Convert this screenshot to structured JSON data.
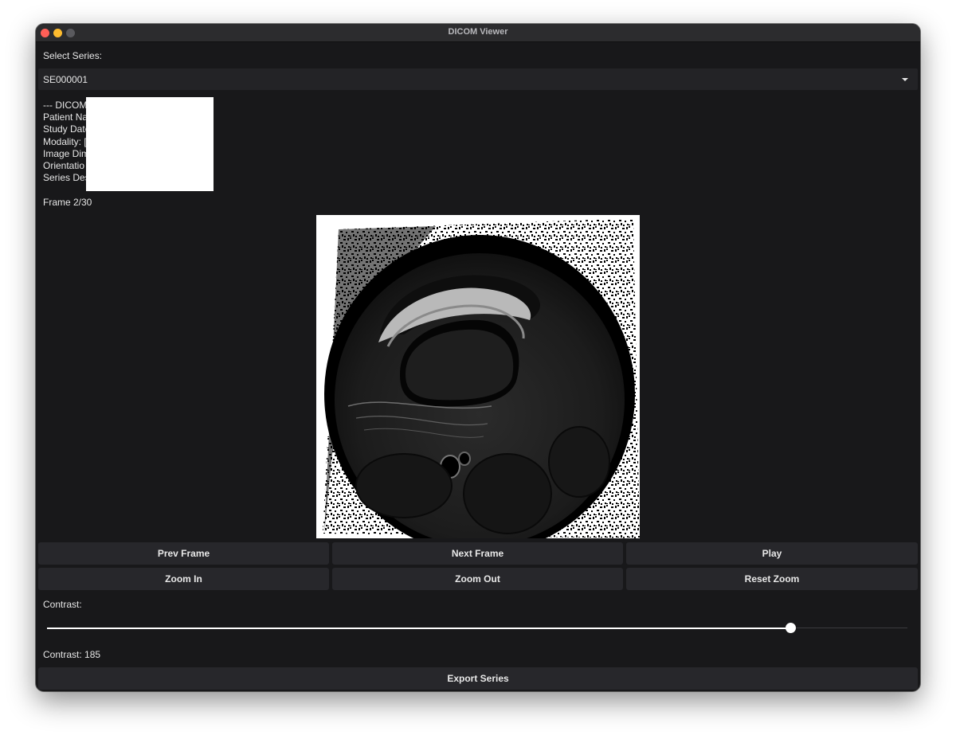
{
  "window": {
    "title": "DICOM Viewer"
  },
  "series": {
    "label": "Select Series:",
    "selected": "SE000001"
  },
  "dicom_info": {
    "lines": [
      "--- DICOM",
      "Patient Na",
      "Study Date",
      "Modality: [",
      "Image Dim",
      "Orientatio",
      "Series Des"
    ]
  },
  "frame": {
    "label": "Frame 2/30",
    "current": 2,
    "total": 30
  },
  "controls": {
    "prev_frame": "Prev Frame",
    "next_frame": "Next Frame",
    "play": "Play",
    "zoom_in": "Zoom In",
    "zoom_out": "Zoom Out",
    "reset_zoom": "Reset Zoom",
    "export": "Export Series"
  },
  "contrast": {
    "label": "Contrast:",
    "value_label": "Contrast: 185",
    "value": 185,
    "fraction": 0.865
  },
  "colors": {
    "background": "#18181a",
    "button": "#27272b",
    "text": "#e6e6e6",
    "close": "#ff5f57",
    "minimize": "#febc2e"
  }
}
